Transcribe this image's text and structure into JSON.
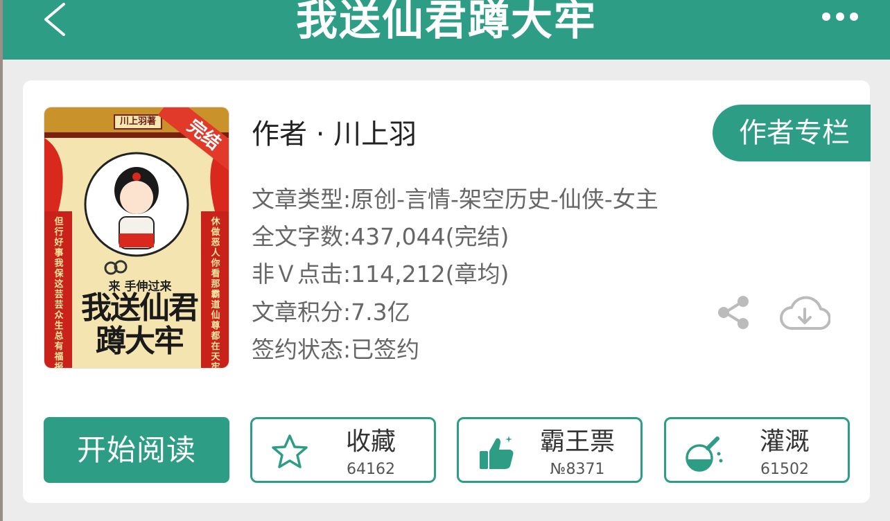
{
  "header": {
    "title": "我送仙君蹲大牢",
    "back_icon": "chevron-left-icon",
    "more_icon": "more-dots-icon"
  },
  "cover": {
    "author_tag": "川上羽著",
    "badge": "完结",
    "subtitle": "来 手伸过来",
    "title_line1": "我送仙君",
    "title_line2": "蹲大牢",
    "couplet_left": "但行好事 我保这芸芸众生总有福报",
    "couplet_right": "休做恶人 你看那霸道仙尊都在天牢"
  },
  "info": {
    "author_line": "作者 · 川上羽",
    "author_column_button": "作者专栏",
    "rows": [
      {
        "label": "文章类型:",
        "value": "原创-言情-架空历史-仙侠-女主"
      },
      {
        "label": "全文字数:",
        "value": "437,044(完结)"
      },
      {
        "label": "非Ｖ点击:",
        "value": "114,212(章均)"
      },
      {
        "label": "文章积分:",
        "value": "7.3亿"
      },
      {
        "label": "签约状态:",
        "value": "已签约"
      }
    ],
    "share_icon": "share-icon",
    "download_icon": "cloud-download-icon"
  },
  "actions": {
    "read_button": "开始阅读",
    "favorite": {
      "label": "收藏",
      "count": "64162",
      "icon": "star-icon"
    },
    "vote": {
      "label": "霸王票",
      "count": "№8371",
      "icon": "thumbs-up-icon"
    },
    "water": {
      "label": "灌溉",
      "count": "61502",
      "icon": "flask-icon"
    }
  },
  "colors": {
    "accent": "#2e9d86",
    "background": "#ececec",
    "card": "#ffffff",
    "text_primary": "#222222",
    "text_secondary": "#666666",
    "badge_red": "#e23a2a"
  }
}
